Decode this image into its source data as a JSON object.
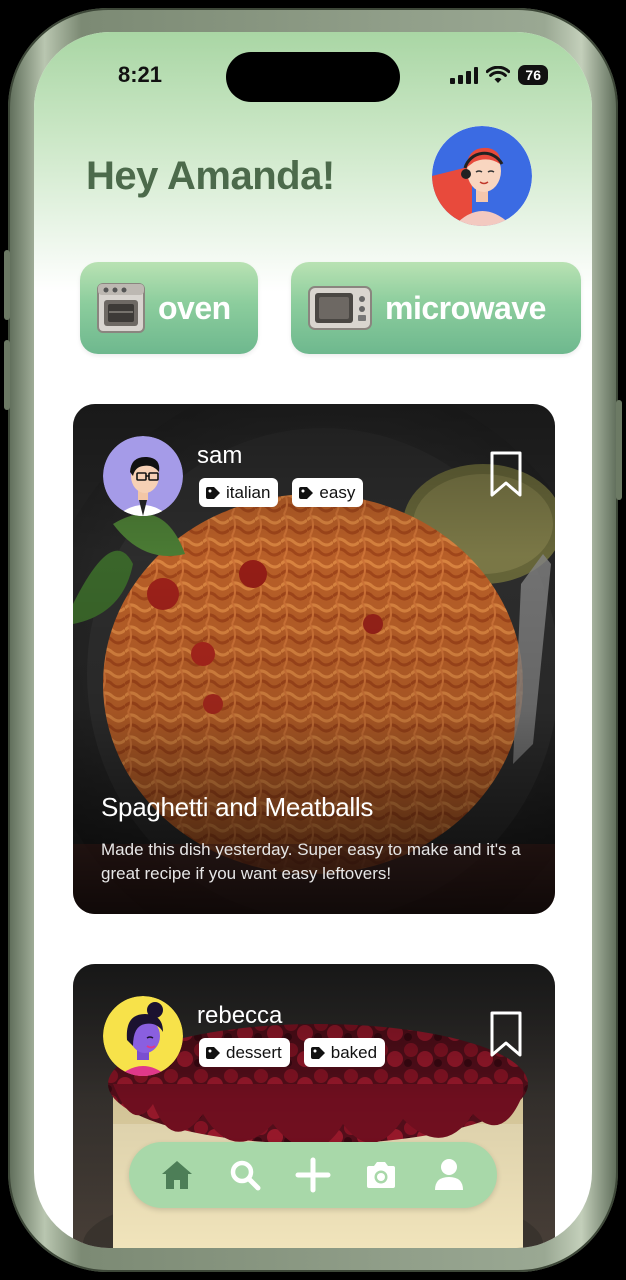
{
  "status_bar": {
    "time": "8:21",
    "battery": "76"
  },
  "header": {
    "greeting": "Hey Amanda!",
    "avatar_icon": "woman-with-headset-avatar"
  },
  "appliances": [
    {
      "label": "oven",
      "icon": "oven-icon"
    },
    {
      "label": "microwave",
      "icon": "microwave-icon"
    }
  ],
  "posts": [
    {
      "user": "sam",
      "avatar_icon": "man-with-glasses-avatar",
      "tags": [
        "italian",
        "easy"
      ],
      "title": "Spaghetti and Meatballs",
      "description": "Made this dish yesterday. Super easy to make and it's a great recipe if you want easy leftovers!",
      "image": "spaghetti-photo"
    },
    {
      "user": "rebecca",
      "avatar_icon": "woman-purple-avatar",
      "tags": [
        "dessert",
        "baked"
      ],
      "image": "berry-cheesecake-photo"
    }
  ],
  "tab_bar": [
    "home-icon",
    "search-icon",
    "plus-icon",
    "camera-icon",
    "profile-icon"
  ],
  "colors": {
    "accent_green": "#8ccd9d",
    "tab_bar": "#a8d8a9",
    "greeting_text": "#4c6a4b"
  }
}
